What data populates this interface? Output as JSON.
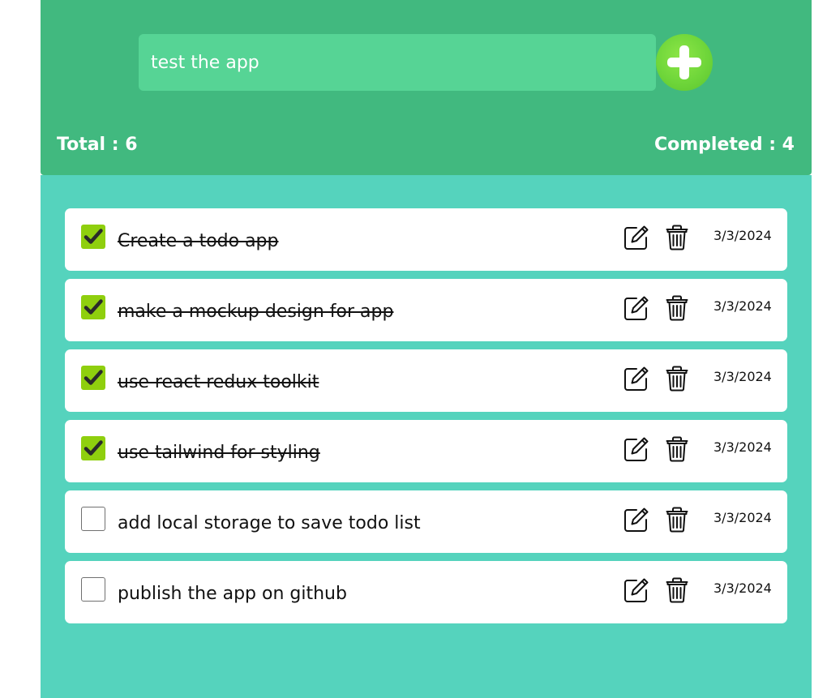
{
  "input": {
    "value": "test the app",
    "placeholder": ""
  },
  "stats": {
    "total": "Total : 6",
    "completed": "Completed : 4"
  },
  "colors": {
    "header_bg": "#41b97f",
    "input_bg": "#56d495",
    "list_bg": "#55d3bd",
    "add_button": "#6fd63a",
    "checkbox_checked": "#8fcf0e"
  },
  "icons": {
    "add": "plus-circle-icon",
    "edit": "pencil-square-icon",
    "delete": "trash-icon",
    "check": "checkmark-icon"
  },
  "todos": [
    {
      "text": "Create a todo app",
      "completed": true,
      "date": "3/3/2024"
    },
    {
      "text": "make a mockup design for app",
      "completed": true,
      "date": "3/3/2024"
    },
    {
      "text": "use react redux toolkit",
      "completed": true,
      "date": "3/3/2024"
    },
    {
      "text": "use tailwind for styling",
      "completed": true,
      "date": "3/3/2024"
    },
    {
      "text": "add local storage to save todo list",
      "completed": false,
      "date": "3/3/2024"
    },
    {
      "text": "publish the app on github",
      "completed": false,
      "date": "3/3/2024"
    }
  ]
}
